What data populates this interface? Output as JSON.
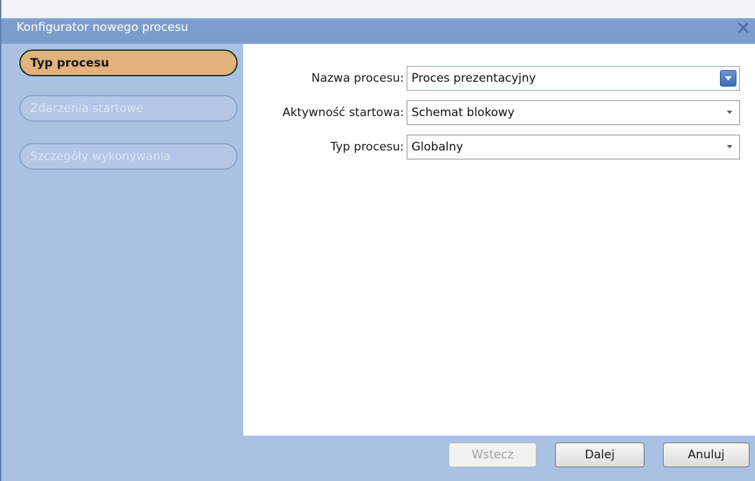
{
  "window": {
    "title": "Konfigurator nowego procesu",
    "close_glyph": "✕"
  },
  "sidebar": {
    "steps": [
      {
        "label": "Typ procesu",
        "state": "active"
      },
      {
        "label": "Zdarzenia startowe",
        "state": "inactive"
      },
      {
        "label": "Szczegóły wykonywania",
        "state": "inactive"
      }
    ]
  },
  "form": {
    "process_name": {
      "label": "Nazwa procesu:",
      "value": "Proces prezentacyjny"
    },
    "start_activity": {
      "label": "Aktywność startowa:",
      "value": "Schemat blokowy"
    },
    "process_type": {
      "label": "Typ procesu:",
      "value": "Globalny"
    }
  },
  "buttons": {
    "back": "Wstecz",
    "next": "Dalej",
    "cancel": "Anuluj"
  },
  "colors": {
    "panel_bg": "#a9c1e2",
    "active_step": "#e1b27b"
  }
}
